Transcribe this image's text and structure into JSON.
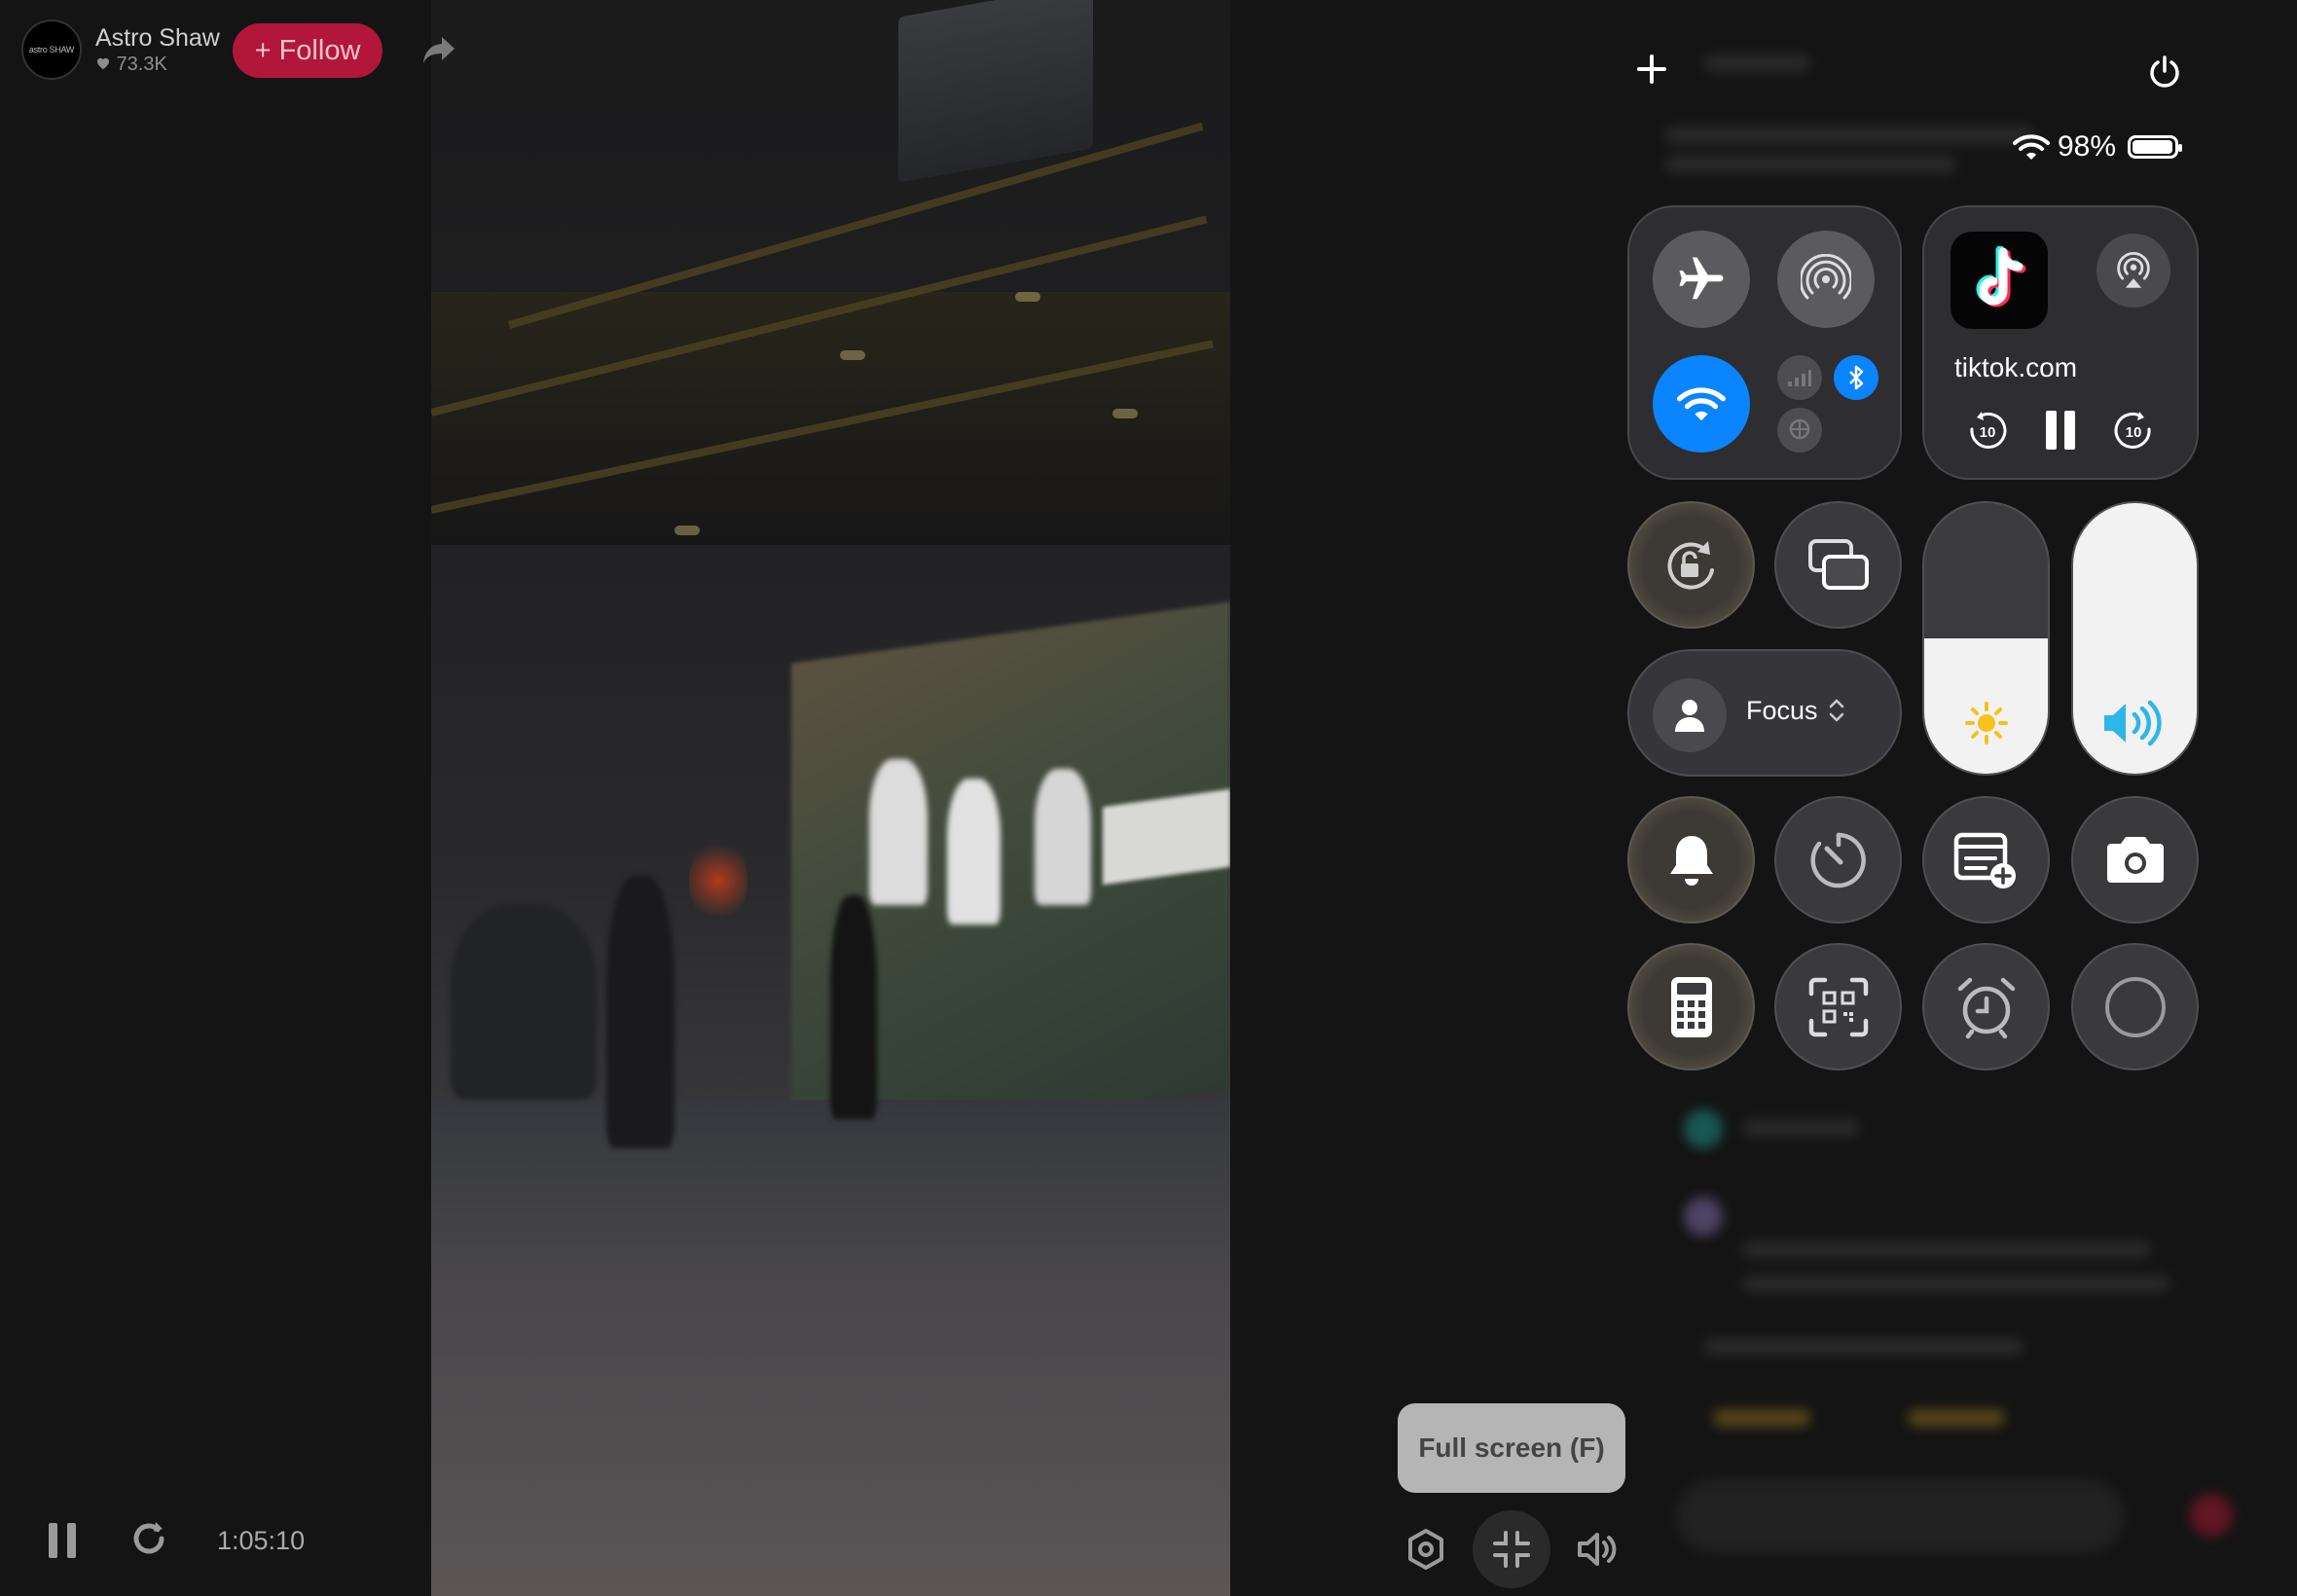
{
  "creator": {
    "avatar_text": "astro SHAW",
    "name": "Astro Shaw",
    "likes": "73.3K",
    "follow_label": "+ Follow"
  },
  "player": {
    "timecode": "1:05:10",
    "tooltip": "Full screen (F)"
  },
  "status_bar": {
    "battery": "98%",
    "battery_level": 0.98
  },
  "control_center": {
    "media": {
      "source": "tiktok.com",
      "skip_back": "10",
      "skip_forward": "10"
    },
    "focus_label": "Focus",
    "brightness_level": 0.5,
    "volume_level": 1.0,
    "wifi_on": true,
    "bluetooth_on": true
  },
  "colors": {
    "accent_blue": "#0a84ff",
    "follow_red": "#b2163a",
    "sun_yellow": "#f6c21b",
    "volume_cyan": "#2fb6e8"
  },
  "icons": [
    "share-icon",
    "pause-icon",
    "replay-icon",
    "settings-icon",
    "exit-fullscreen-icon",
    "volume-icon",
    "plus-icon",
    "power-icon",
    "wifi-icon",
    "airplane-icon",
    "hotspot-icon",
    "cellular-icon",
    "bluetooth-icon",
    "vpn-icon",
    "airplay-icon",
    "tiktok-icon",
    "orientation-lock-icon",
    "screen-mirroring-icon",
    "person-icon",
    "sun-icon",
    "speaker-icon",
    "bell-icon",
    "timer-icon",
    "quick-note-icon",
    "camera-icon",
    "calculator-icon",
    "qr-code-icon",
    "alarm-icon",
    "screen-record-icon"
  ]
}
